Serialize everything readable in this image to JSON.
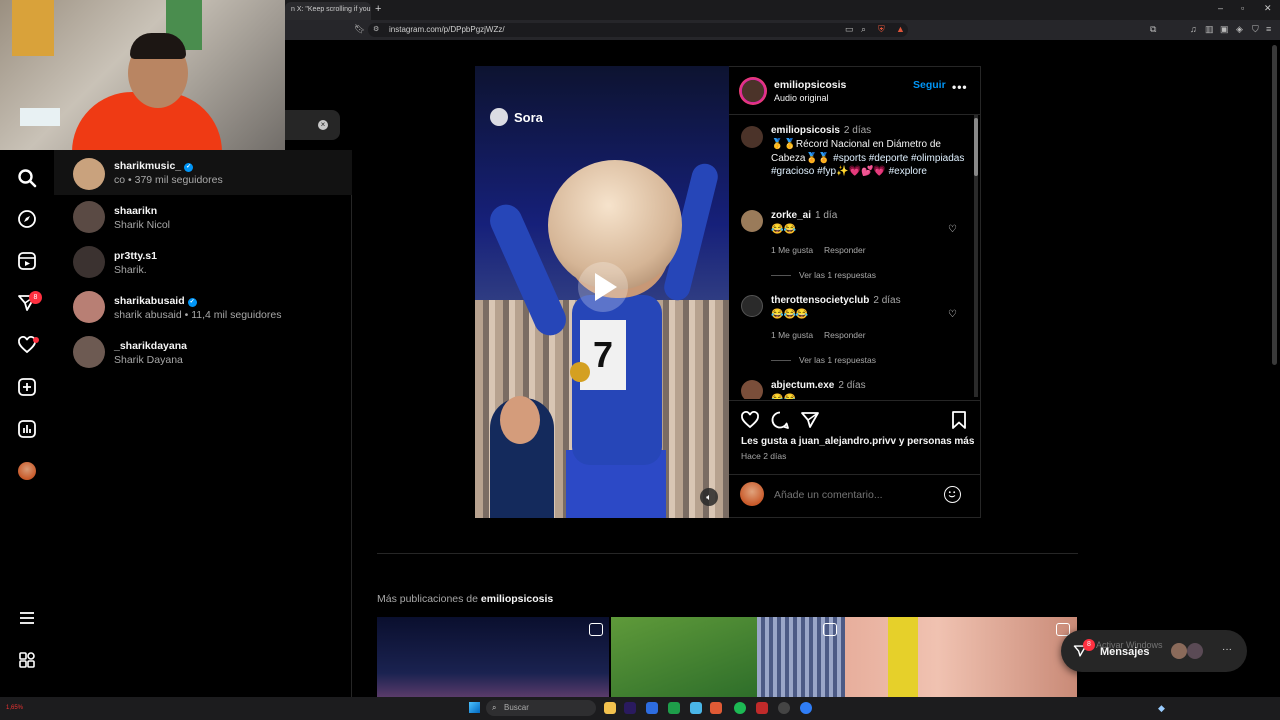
{
  "browser": {
    "tab_title": "n X: \"Keep scrolling if your n",
    "new_tab": "+",
    "url": "instagram.com/p/DPpbPgzjWZz/",
    "window_controls": [
      "–",
      "▫",
      "✕"
    ]
  },
  "search_panel": {
    "clear_icon": "×",
    "results": [
      {
        "username": "sharikmusic_",
        "verified": true,
        "subtitle": "co • 379 mil seguidores",
        "avatar_color": "#c9a27d"
      },
      {
        "username": "shaarikn",
        "verified": false,
        "subtitle": "Sharik Nicol",
        "avatar_color": "#5a4a44"
      },
      {
        "username": "pr3tty.s1",
        "verified": false,
        "subtitle": "Sharik.",
        "avatar_color": "#3b3230"
      },
      {
        "username": "sharikabusaid",
        "verified": true,
        "subtitle": "sharik abusaid • 11,4 mil seguidores",
        "avatar_color": "#b87f74"
      },
      {
        "username": "_sharikdayana",
        "verified": false,
        "subtitle": "Sharik Dayana",
        "avatar_color": "#6d5a52"
      }
    ]
  },
  "sidebar": {
    "messages_badge": "8"
  },
  "post": {
    "sora_label": "Sora",
    "bib_number": "7",
    "owner": "emiliopsicosis",
    "audio": "Audio original",
    "follow": "Seguir",
    "more": "•••",
    "caption": {
      "username": "emiliopsicosis",
      "time": "2 días",
      "text_plain": "🥇🥇Récord Nacional en Diámetro de Cabeza🏅🏅",
      "tags": "#sports #deporte #olimpiadas #gracioso #fyp✨💗💕💗 #explore"
    },
    "comments": [
      {
        "username": "zorke_ai",
        "time": "1 día",
        "text": "😂😂",
        "likes": "1 Me gusta",
        "reply": "Responder",
        "view_replies": "Ver las 1 respuestas"
      },
      {
        "username": "therottensocietyclub",
        "time": "2 días",
        "text": "😂😂😂",
        "likes": "1 Me gusta",
        "reply": "Responder",
        "view_replies": "Ver las 1 respuestas"
      },
      {
        "username": "abjectum.exe",
        "time": "2 días",
        "text": "😂😂"
      }
    ],
    "liked_by": "Les gusta a juan_alejandro.privv y personas más",
    "posted_ago": "Hace 2 días",
    "comment_placeholder": "Añade un comentario..."
  },
  "more_posts": {
    "prefix": "Más publicaciones de",
    "owner": "emiliopsicosis"
  },
  "messages": {
    "label": "Mensajes",
    "badge": "8",
    "more": "···",
    "watermark": "Activar Windows"
  },
  "taskbar": {
    "search_placeholder": "Buscar",
    "cpu": "1,65%"
  },
  "colors": {
    "accent": "#0095f6",
    "notification": "#ff3040",
    "background": "#000000",
    "border": "#262626"
  }
}
